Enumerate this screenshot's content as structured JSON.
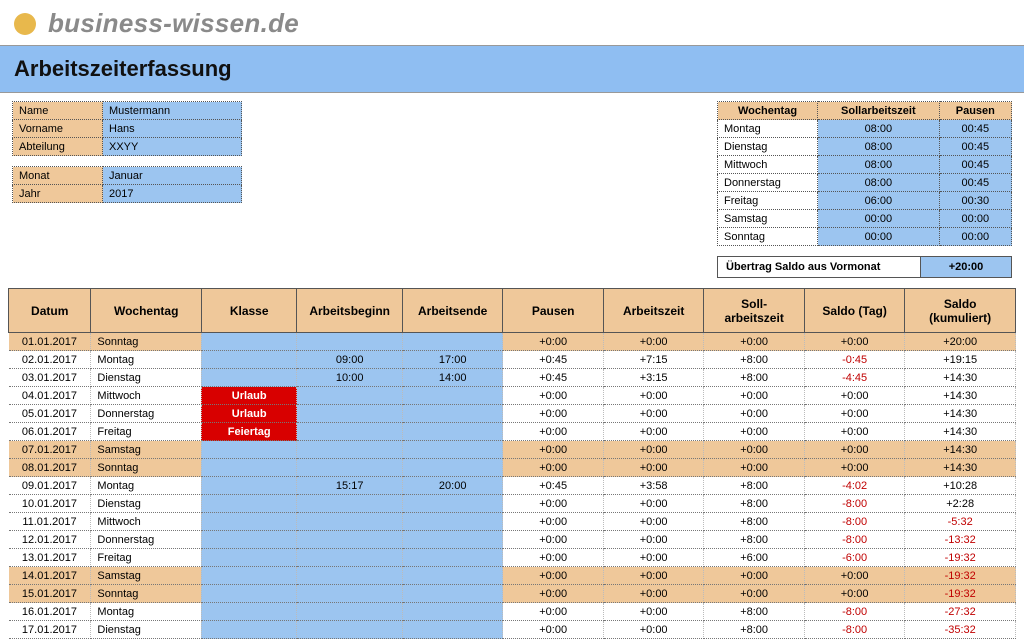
{
  "brand": "business-wissen.de",
  "title": "Arbeitszeiterfassung",
  "employee": {
    "labels": {
      "name": "Name",
      "vorname": "Vorname",
      "abteilung": "Abteilung"
    },
    "name": "Mustermann",
    "vorname": "Hans",
    "abteilung": "XXYY"
  },
  "period": {
    "labels": {
      "monat": "Monat",
      "jahr": "Jahr"
    },
    "monat": "Januar",
    "jahr": "2017"
  },
  "week_table": {
    "headers": {
      "day": "Wochentag",
      "soll": "Sollarbeitszeit",
      "pause": "Pausen"
    },
    "rows": [
      {
        "day": "Montag",
        "soll": "08:00",
        "pause": "00:45"
      },
      {
        "day": "Dienstag",
        "soll": "08:00",
        "pause": "00:45"
      },
      {
        "day": "Mittwoch",
        "soll": "08:00",
        "pause": "00:45"
      },
      {
        "day": "Donnerstag",
        "soll": "08:00",
        "pause": "00:45"
      },
      {
        "day": "Freitag",
        "soll": "06:00",
        "pause": "00:30"
      },
      {
        "day": "Samstag",
        "soll": "00:00",
        "pause": "00:00"
      },
      {
        "day": "Sonntag",
        "soll": "00:00",
        "pause": "00:00"
      }
    ]
  },
  "carry": {
    "label": "Übertrag Saldo aus Vormonat",
    "value": "+20:00"
  },
  "grid_headers": {
    "date": "Datum",
    "day": "Wochentag",
    "klasse": "Klasse",
    "begin": "Arbeitsbeginn",
    "end": "Arbeitsende",
    "pause": "Pausen",
    "work": "Arbeitszeit",
    "soll": "Soll-\narbeitszeit",
    "saldo": "Saldo (Tag)",
    "cum": "Saldo\n(kumuliert)"
  },
  "rows": [
    {
      "date": "01.01.2017",
      "day": "Sonntag",
      "klasse": "",
      "begin": "",
      "end": "",
      "pause": "+0:00",
      "work": "+0:00",
      "soll": "+0:00",
      "saldo": "+0:00",
      "cum": "+20:00",
      "weekend": true
    },
    {
      "date": "02.01.2017",
      "day": "Montag",
      "klasse": "",
      "begin": "09:00",
      "end": "17:00",
      "pause": "+0:45",
      "work": "+7:15",
      "soll": "+8:00",
      "saldo": "-0:45",
      "saldo_neg": true,
      "cum": "+19:15"
    },
    {
      "date": "03.01.2017",
      "day": "Dienstag",
      "klasse": "",
      "begin": "10:00",
      "end": "14:00",
      "pause": "+0:45",
      "work": "+3:15",
      "soll": "+8:00",
      "saldo": "-4:45",
      "saldo_neg": true,
      "cum": "+14:30"
    },
    {
      "date": "04.01.2017",
      "day": "Mittwoch",
      "klasse": "Urlaub",
      "klasse_red": true,
      "begin": "",
      "end": "",
      "pause": "+0:00",
      "work": "+0:00",
      "soll": "+0:00",
      "saldo": "+0:00",
      "cum": "+14:30"
    },
    {
      "date": "05.01.2017",
      "day": "Donnerstag",
      "klasse": "Urlaub",
      "klasse_red": true,
      "begin": "",
      "end": "",
      "pause": "+0:00",
      "work": "+0:00",
      "soll": "+0:00",
      "saldo": "+0:00",
      "cum": "+14:30"
    },
    {
      "date": "06.01.2017",
      "day": "Freitag",
      "klasse": "Feiertag",
      "klasse_red": true,
      "begin": "",
      "end": "",
      "pause": "+0:00",
      "work": "+0:00",
      "soll": "+0:00",
      "saldo": "+0:00",
      "cum": "+14:30"
    },
    {
      "date": "07.01.2017",
      "day": "Samstag",
      "klasse": "",
      "begin": "",
      "end": "",
      "pause": "+0:00",
      "work": "+0:00",
      "soll": "+0:00",
      "saldo": "+0:00",
      "cum": "+14:30",
      "weekend": true
    },
    {
      "date": "08.01.2017",
      "day": "Sonntag",
      "klasse": "",
      "begin": "",
      "end": "",
      "pause": "+0:00",
      "work": "+0:00",
      "soll": "+0:00",
      "saldo": "+0:00",
      "cum": "+14:30",
      "weekend": true
    },
    {
      "date": "09.01.2017",
      "day": "Montag",
      "klasse": "",
      "begin": "15:17",
      "end": "20:00",
      "pause": "+0:45",
      "work": "+3:58",
      "soll": "+8:00",
      "saldo": "-4:02",
      "saldo_neg": true,
      "cum": "+10:28"
    },
    {
      "date": "10.01.2017",
      "day": "Dienstag",
      "klasse": "",
      "begin": "",
      "end": "",
      "pause": "+0:00",
      "work": "+0:00",
      "soll": "+8:00",
      "saldo": "-8:00",
      "saldo_neg": true,
      "cum": "+2:28"
    },
    {
      "date": "11.01.2017",
      "day": "Mittwoch",
      "klasse": "",
      "begin": "",
      "end": "",
      "pause": "+0:00",
      "work": "+0:00",
      "soll": "+8:00",
      "saldo": "-8:00",
      "saldo_neg": true,
      "cum": "-5:32",
      "cum_neg": true
    },
    {
      "date": "12.01.2017",
      "day": "Donnerstag",
      "klasse": "",
      "begin": "",
      "end": "",
      "pause": "+0:00",
      "work": "+0:00",
      "soll": "+8:00",
      "saldo": "-8:00",
      "saldo_neg": true,
      "cum": "-13:32",
      "cum_neg": true
    },
    {
      "date": "13.01.2017",
      "day": "Freitag",
      "klasse": "",
      "begin": "",
      "end": "",
      "pause": "+0:00",
      "work": "+0:00",
      "soll": "+6:00",
      "saldo": "-6:00",
      "saldo_neg": true,
      "cum": "-19:32",
      "cum_neg": true
    },
    {
      "date": "14.01.2017",
      "day": "Samstag",
      "klasse": "",
      "begin": "",
      "end": "",
      "pause": "+0:00",
      "work": "+0:00",
      "soll": "+0:00",
      "saldo": "+0:00",
      "cum": "-19:32",
      "cum_neg": true,
      "weekend": true
    },
    {
      "date": "15.01.2017",
      "day": "Sonntag",
      "klasse": "",
      "begin": "",
      "end": "",
      "pause": "+0:00",
      "work": "+0:00",
      "soll": "+0:00",
      "saldo": "+0:00",
      "cum": "-19:32",
      "cum_neg": true,
      "weekend": true
    },
    {
      "date": "16.01.2017",
      "day": "Montag",
      "klasse": "",
      "begin": "",
      "end": "",
      "pause": "+0:00",
      "work": "+0:00",
      "soll": "+8:00",
      "saldo": "-8:00",
      "saldo_neg": true,
      "cum": "-27:32",
      "cum_neg": true
    },
    {
      "date": "17.01.2017",
      "day": "Dienstag",
      "klasse": "",
      "begin": "",
      "end": "",
      "pause": "+0:00",
      "work": "+0:00",
      "soll": "+8:00",
      "saldo": "-8:00",
      "saldo_neg": true,
      "cum": "-35:32",
      "cum_neg": true
    }
  ]
}
